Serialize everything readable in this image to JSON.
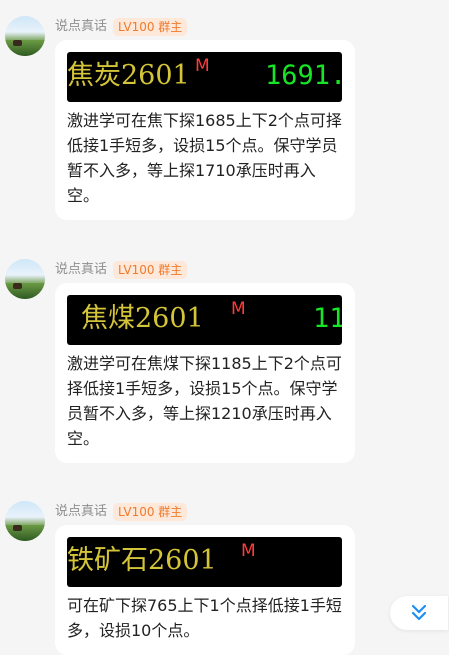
{
  "messages": [
    {
      "sender": "说点真话",
      "badge": "LV100 群主",
      "quote": {
        "name": "焦炭2601",
        "marker": "M",
        "price": "1691."
      },
      "text": "激进学可在焦下探1685上下2个点可择低接1手短多，设损15个点。保守学员暂不入多，等上探1710承压时再入空。"
    },
    {
      "sender": "说点真话",
      "badge": "LV100 群主",
      "quote": {
        "name": "焦煤2601",
        "marker": "M",
        "price": "11"
      },
      "text": "激进学可在焦煤下探1185上下2个点可择低接1手短多，设损15个点。保守学员暂不入多，等上探1210承压时再入空。"
    },
    {
      "sender": "说点真话",
      "badge": "LV100 群主",
      "quote": {
        "name": "铁矿石2601",
        "marker": "M",
        "price": ""
      },
      "text": "可在矿下探765上下1个点择低接1手短多，设损10个点。"
    }
  ],
  "scroll_button": {
    "icon": "double-chevron-down-icon",
    "color": "#1e8ff0"
  }
}
